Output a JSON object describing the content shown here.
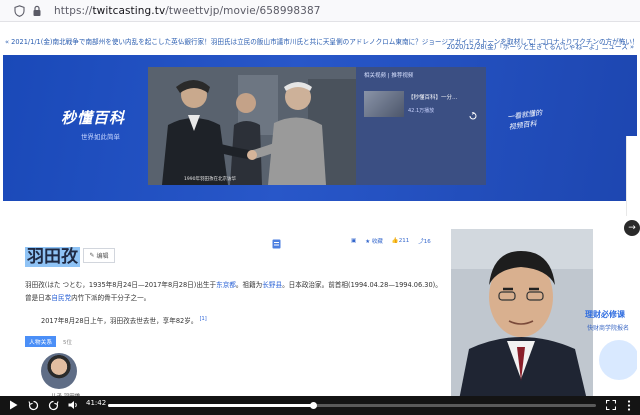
{
  "browser": {
    "url_scheme": "https://",
    "url_host": "twitcasting.tv",
    "url_path": "/tweettvjp/movie/658998387"
  },
  "blog_nav": {
    "prev_link": "« 2021/1/1(金)南北戦争で南部州を使い内乱を起こした英仏銀行家！羽田氏は立民の飯山市議市川氏と共に天皇側のアドレノクロム東南に？ジョージアガイドストーンを取材して！コロナよりワクチンの方が怖い！…",
    "next_link": "2020/12/28(金)「ボーッと生きてるんじゃねーよ」ニュース »"
  },
  "banner": {
    "logo": "秒懂百科",
    "subtitle": "世界如此简单",
    "photo_caption": "1990年羽田孜在北京访华",
    "side_header": "相关视频 | 推荐视频",
    "side_video_title": "【秒懂百科】一分…",
    "side_video_views": "42.1万播放",
    "handwriting_line1": "一看就懂的",
    "handwriting_line2": "视频百科"
  },
  "article": {
    "name": "羽田孜",
    "edit_label": "编辑",
    "actions": {
      "collect": "收藏",
      "like_count": "211",
      "share_count": "16"
    },
    "para1_a": "羽田孜(はた つとむ，1935年8月24日—2017年8月28日)出生于",
    "para1_link1": "东京都",
    "para1_b": "。祖籍为",
    "para1_link2": "长野县",
    "para1_c": "。日本政治家。前首相(1994.04.28—1994.06.30)。曾是日本",
    "para1_link3": "自民党",
    "para1_d": "内竹下派的骨干分子之一。",
    "para2": "2017年8月28日上午，羽田孜去世去世，享年82岁。",
    "para2_ref": "[1]",
    "relation_tag": "人物关系",
    "relation_count": "5位",
    "relation_caption": "儿子  羽田雄…"
  },
  "ad": {
    "line1": "理财必修课",
    "line2": "快财商学院报名"
  },
  "player": {
    "current_time": "41:42",
    "progress_fraction": 0.42
  },
  "colors": {
    "banner_blue": "#1f4fc0",
    "link_blue": "#2a5db0",
    "control_bar": "#141414"
  }
}
